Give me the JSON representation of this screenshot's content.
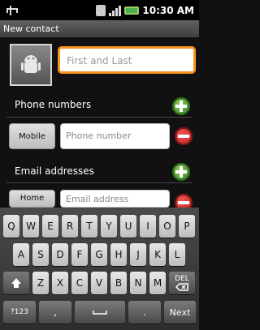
{
  "status": {
    "time": "10:30 AM",
    "icons": [
      "usb-icon",
      "sim-icon",
      "signal-icon",
      "battery-icon"
    ],
    "battery_color": "#4caf50"
  },
  "title": "New contact",
  "form": {
    "name_placeholder": "First and Last",
    "phone_section": "Phone numbers",
    "phone_type": "Mobile",
    "phone_placeholder": "Phone number",
    "email_section": "Email addresses",
    "email_type": "Home",
    "email_placeholder": "Email address"
  },
  "keyboard": {
    "row1": [
      "Q",
      "W",
      "E",
      "R",
      "T",
      "Y",
      "U",
      "I",
      "O",
      "P"
    ],
    "row2": [
      "A",
      "S",
      "D",
      "F",
      "G",
      "H",
      "J",
      "K",
      "L"
    ],
    "row3": [
      "Z",
      "X",
      "C",
      "V",
      "B",
      "N",
      "M"
    ],
    "del_label": "DEL",
    "symbols_label": "?123",
    "comma": ",",
    "period": ".",
    "next_label": "Next"
  },
  "colors": {
    "focus_border": "#f7941d",
    "add_button": "#2e7d32",
    "remove_button": "#b71c1c"
  }
}
